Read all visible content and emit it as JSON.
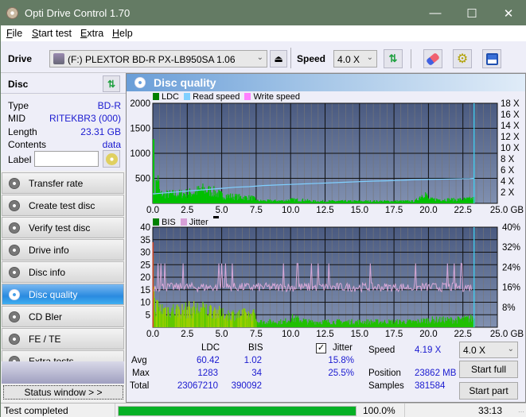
{
  "window": {
    "title": "Opti Drive Control 1.70",
    "minimize": "—",
    "maximize": "☐",
    "close": "✕"
  },
  "menu": [
    {
      "label": "File",
      "u": "F",
      "rest": "ile"
    },
    {
      "label": "Start test",
      "u": "S",
      "rest": "tart test"
    },
    {
      "label": "Extra",
      "u": "E",
      "rest": "xtra"
    },
    {
      "label": "Help",
      "u": "H",
      "rest": "elp"
    }
  ],
  "toolbar": {
    "drive_label": "Drive",
    "drive_value": "(F:)  PLEXTOR BD-R  PX-LB950SA 1.06",
    "speed_label": "Speed",
    "speed_value": "4.0 X"
  },
  "disc": {
    "header": "Disc",
    "type_k": "Type",
    "type_v": "BD-R",
    "mid_k": "MID",
    "mid_v": "RITEKBR3 (000)",
    "length_k": "Length",
    "length_v": "23.31 GB",
    "contents_k": "Contents",
    "contents_v": "data",
    "label_k": "Label",
    "label_value": ""
  },
  "nav": [
    {
      "label": "Transfer rate",
      "active": false
    },
    {
      "label": "Create test disc",
      "active": false
    },
    {
      "label": "Verify test disc",
      "active": false
    },
    {
      "label": "Drive info",
      "active": false
    },
    {
      "label": "Disc info",
      "active": false
    },
    {
      "label": "Disc quality",
      "active": true
    },
    {
      "label": "CD Bler",
      "active": false
    },
    {
      "label": "FE / TE",
      "active": false
    },
    {
      "label": "Extra tests",
      "active": false
    }
  ],
  "status_window": "Status window > >",
  "main": {
    "title": "Disc quality"
  },
  "chart_data": [
    {
      "type": "bar",
      "title": "LDC / Read speed",
      "legend": [
        "LDC",
        "Read speed",
        "Write speed"
      ],
      "legend_colors": [
        "#008000",
        "#80d0ff",
        "#ff80ff"
      ],
      "xlabel": "GB",
      "xlim": [
        0,
        25
      ],
      "ylim": [
        0,
        2000
      ],
      "y2lim": [
        0,
        18
      ],
      "x_ticks": [
        "0.0",
        "2.5",
        "5.0",
        "7.5",
        "10.0",
        "12.5",
        "15.0",
        "17.5",
        "20.0",
        "22.5",
        "25.0 GB"
      ],
      "y_ticks": [
        "500",
        "1000",
        "1500",
        "2000"
      ],
      "y2_ticks": [
        "2 X",
        "4 X",
        "6 X",
        "8 X",
        "10 X",
        "12 X",
        "14 X",
        "16 X",
        "18 X"
      ],
      "ldc_profile": [
        [
          0,
          1283
        ],
        [
          0.1,
          300
        ],
        [
          0.3,
          730
        ],
        [
          0.5,
          260
        ],
        [
          1.0,
          250
        ],
        [
          2.0,
          260
        ],
        [
          3.0,
          300
        ],
        [
          3.5,
          380
        ],
        [
          4.3,
          330
        ],
        [
          5.0,
          220
        ],
        [
          6.0,
          180
        ],
        [
          7.2,
          150
        ],
        [
          7.6,
          70
        ],
        [
          9.5,
          70
        ],
        [
          10.0,
          100
        ],
        [
          11.0,
          90
        ],
        [
          11.5,
          60
        ],
        [
          19.0,
          60
        ],
        [
          19.7,
          300
        ],
        [
          20.0,
          110
        ],
        [
          22.0,
          100
        ],
        [
          23.3,
          130
        ]
      ],
      "read_speed": [
        [
          0,
          1.7
        ],
        [
          1,
          1.9
        ],
        [
          2,
          2.1
        ],
        [
          3,
          2.3
        ],
        [
          4,
          2.5
        ],
        [
          5,
          2.7
        ],
        [
          6,
          2.9
        ],
        [
          7,
          3.0
        ],
        [
          8,
          3.2
        ],
        [
          9,
          3.3
        ],
        [
          10,
          3.4
        ],
        [
          11,
          3.5
        ],
        [
          12,
          3.6
        ],
        [
          13,
          3.7
        ],
        [
          14,
          3.8
        ],
        [
          15,
          3.9
        ],
        [
          16,
          4.0
        ],
        [
          17,
          4.05
        ],
        [
          18,
          4.15
        ],
        [
          19,
          4.25
        ],
        [
          20,
          4.3
        ],
        [
          21,
          4.35
        ],
        [
          22,
          4.4
        ],
        [
          23,
          4.45
        ],
        [
          23.3,
          4.5
        ]
      ],
      "end_marker_gb": 23.31
    },
    {
      "type": "bar",
      "title": "BIS / Jitter",
      "legend": [
        "BIS",
        "Jitter"
      ],
      "legend_colors": [
        "#008000",
        "#d8a0d8"
      ],
      "xlabel": "GB",
      "xlim": [
        0,
        25
      ],
      "ylim": [
        0,
        40
      ],
      "y2lim": [
        0,
        40
      ],
      "x_ticks": [
        "0.0",
        "2.5",
        "5.0",
        "7.5",
        "10.0",
        "12.5",
        "15.0",
        "17.5",
        "20.0",
        "22.5",
        "25.0 GB"
      ],
      "y_ticks": [
        "5",
        "10",
        "15",
        "20",
        "25",
        "30",
        "35",
        "40"
      ],
      "y2_ticks": [
        "8%",
        "16%",
        "24%",
        "32%",
        "40%"
      ],
      "bis_profile": [
        [
          0,
          34
        ],
        [
          0.1,
          12
        ],
        [
          0.5,
          10
        ],
        [
          2.0,
          9
        ],
        [
          3.0,
          10
        ],
        [
          4.5,
          9
        ],
        [
          5.0,
          7
        ],
        [
          7.3,
          7
        ],
        [
          7.6,
          3
        ],
        [
          9.5,
          3
        ],
        [
          10.0,
          5
        ],
        [
          10.8,
          4
        ],
        [
          11.2,
          3
        ],
        [
          19.0,
          3
        ],
        [
          20.0,
          4
        ],
        [
          22.0,
          4
        ],
        [
          23.3,
          5
        ]
      ],
      "jitter_base": 16,
      "jitter_spikes_gb": [
        0.4,
        0.6,
        0.9,
        2.2,
        4.8,
        5.0,
        5.3,
        5.8,
        9.5,
        10.5,
        11.5,
        12.0,
        12.8,
        15.8,
        19.1,
        21.4,
        21.9,
        22.4
      ],
      "end_marker_gb": 23.31
    }
  ],
  "stats": {
    "col_ldc": "LDC",
    "col_bis": "BIS",
    "jitter_label": "Jitter",
    "jitter_checked": true,
    "avg_label": "Avg",
    "avg_ldc": "60.42",
    "avg_bis": "1.02",
    "avg_jitter": "15.8%",
    "max_label": "Max",
    "max_ldc": "1283",
    "max_bis": "34",
    "max_jitter": "25.5%",
    "total_label": "Total",
    "total_ldc": "23067210",
    "total_bis": "390092",
    "speed_label": "Speed",
    "speed_value": "4.19 X",
    "position_label": "Position",
    "position_value": "23862 MB",
    "samples_label": "Samples",
    "samples_value": "381584",
    "speed_select": "4.0 X",
    "start_full": "Start full",
    "start_part": "Start part"
  },
  "statusbar": {
    "text": "Test completed",
    "progress_pct": 100,
    "progress_text": "100.0%",
    "time": "33:13"
  }
}
